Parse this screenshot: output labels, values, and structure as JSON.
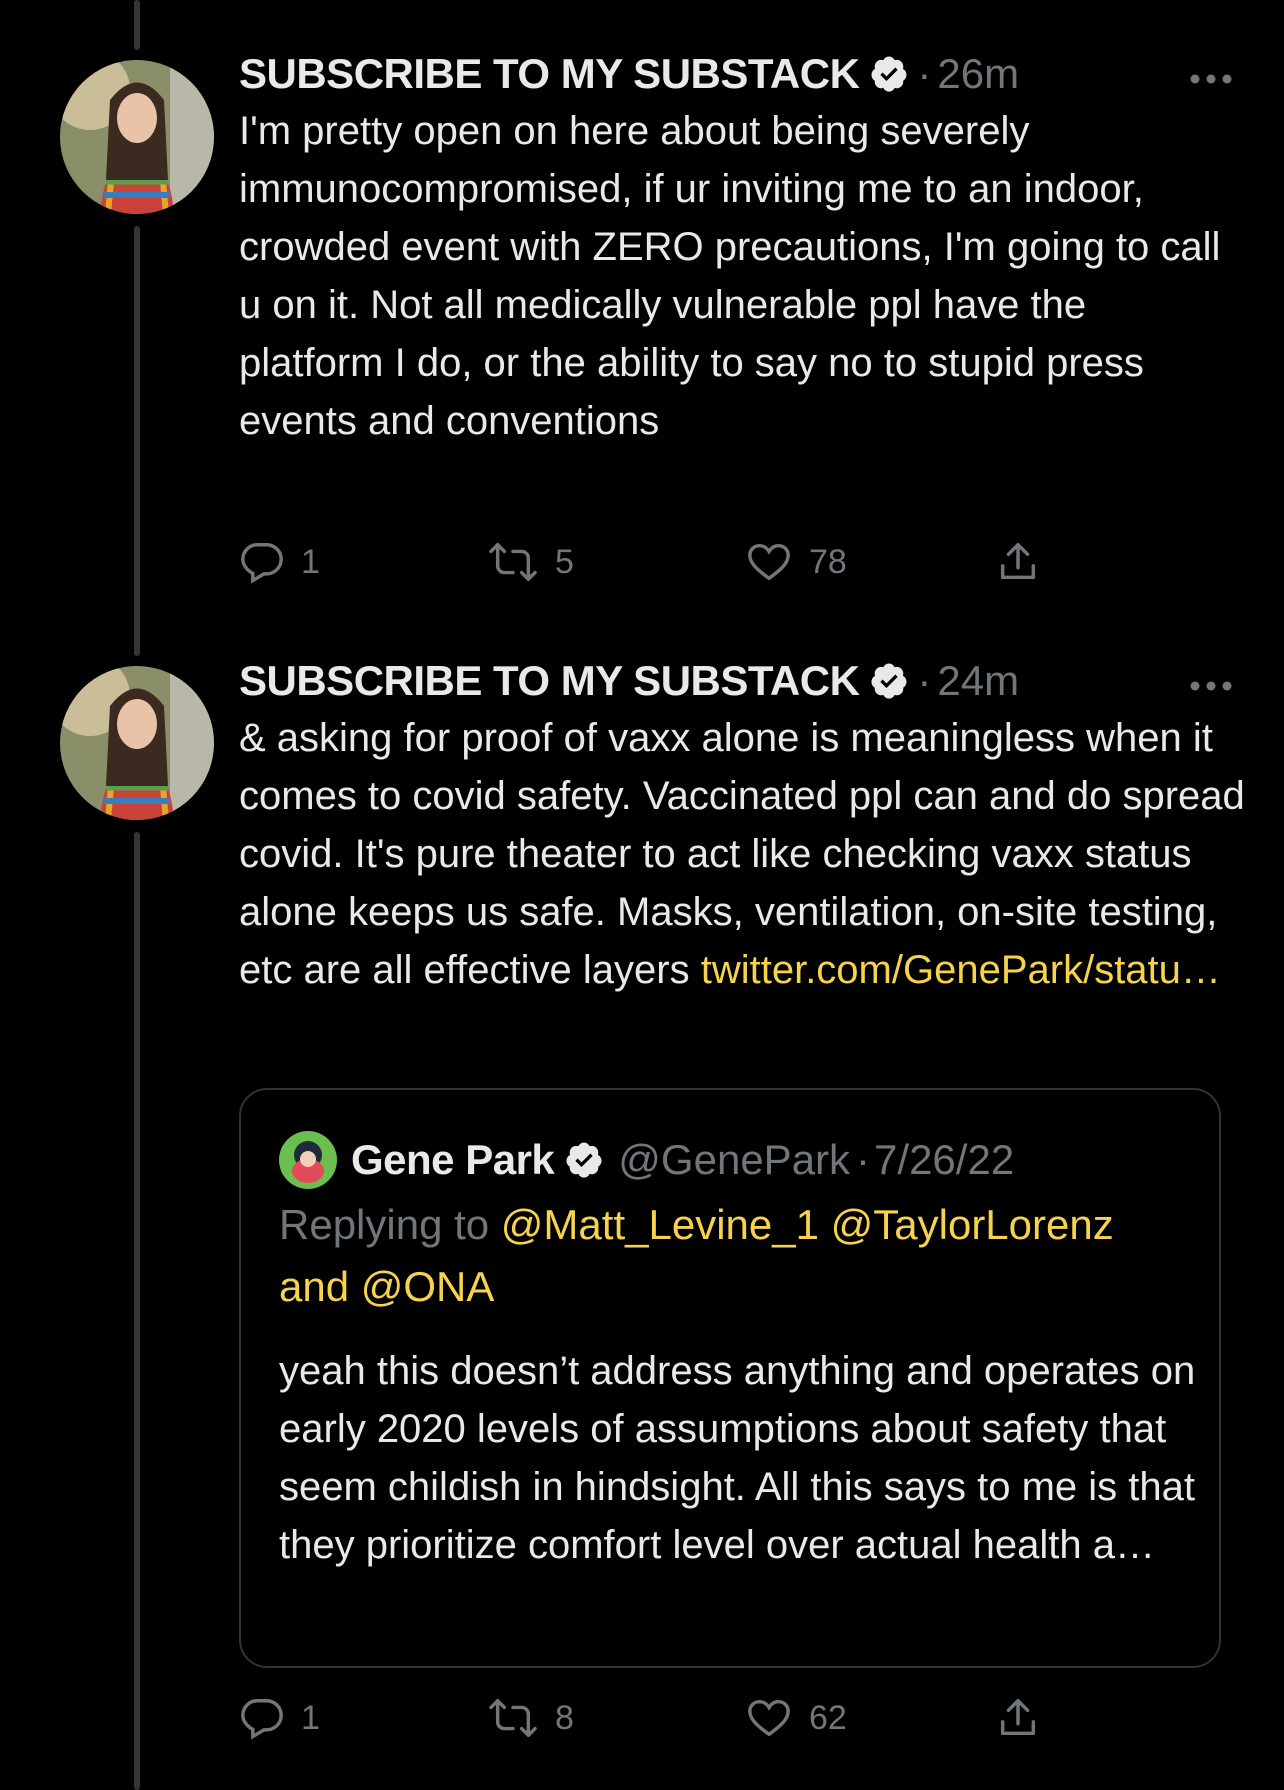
{
  "tweets": [
    {
      "display_name": "SUBSCRIBE TO MY SUBSTACK",
      "separator": "·",
      "time": "26m",
      "text": "I'm pretty open on here about being severely immunocompromised, if ur inviting me to an indoor, crowded event with ZERO precautions, I'm going to call u on it. Not all medically vulnerable ppl have the platform I do, or the ability to say no to stupid press events and conventions",
      "replies": "1",
      "retweets": "5",
      "likes": "78"
    },
    {
      "display_name": "SUBSCRIBE TO MY SUBSTACK",
      "separator": "·",
      "time": "24m",
      "text": "& asking for proof of vaxx alone is meaningless when it comes to covid safety. Vaccinated ppl can and do spread covid. It's pure theater to act like checking vaxx status alone keeps us safe. Masks, ventilation, on-site testing, etc are all effective layers",
      "link_text": "twitter.com/GenePark/statu…",
      "replies": "1",
      "retweets": "8",
      "likes": "62",
      "quote": {
        "display_name": "Gene Park",
        "handle": "@GenePark",
        "separator": "·",
        "date": "7/26/22",
        "replying_prefix": "Replying to",
        "mention_1": "@Matt_Levine_1",
        "mention_2": "@TaylorLorenz",
        "and_word": "and",
        "mention_3": "@ONA",
        "text": "yeah this doesn’t address anything and operates on early 2020 levels of assumptions about safety that seem childish in hindsight. All this says to me is that they prioritize comfort level  over actual health a…"
      }
    }
  ],
  "icons": {
    "reply": "reply-icon",
    "retweet": "retweet-icon",
    "like": "like-icon",
    "share": "share-icon",
    "more": "more-icon",
    "verified": "verified-badge-icon"
  },
  "colors": {
    "background": "#000000",
    "text": "#e7e9ea",
    "muted": "#71767b",
    "link": "#f7d34d",
    "thread_line": "#333639"
  }
}
